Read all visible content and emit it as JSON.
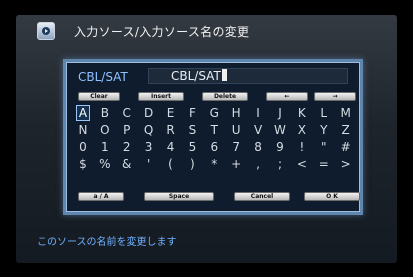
{
  "header": {
    "title": "入力ソース/入力ソース名の変更"
  },
  "editor": {
    "source_label": "CBL/SAT",
    "name_value": "CBL/SAT"
  },
  "buttons_top": [
    {
      "label": "Clear"
    },
    {
      "label": "Insert"
    },
    {
      "label": "Delete"
    },
    {
      "label": "←"
    },
    {
      "label": "→"
    }
  ],
  "keyboard": {
    "selected": "A",
    "rows": [
      [
        "A",
        "B",
        "C",
        "D",
        "E",
        "F",
        "G",
        "H",
        "I",
        "J",
        "K",
        "L",
        "M"
      ],
      [
        "N",
        "O",
        "P",
        "Q",
        "R",
        "S",
        "T",
        "U",
        "V",
        "W",
        "X",
        "Y",
        "Z"
      ],
      [
        "0",
        "1",
        "2",
        "3",
        "4",
        "5",
        "6",
        "7",
        "8",
        "9",
        "!",
        "\"",
        "#"
      ],
      [
        "$",
        "%",
        "&",
        "'",
        "(",
        ")",
        "*",
        "+",
        ",",
        ";",
        "<",
        "=",
        ">"
      ]
    ]
  },
  "buttons_bottom": [
    {
      "label": "a / A"
    },
    {
      "label": "Space"
    },
    {
      "label": "Cancel"
    },
    {
      "label": "O K"
    }
  ],
  "status_text": "このソースの名前を変更します"
}
